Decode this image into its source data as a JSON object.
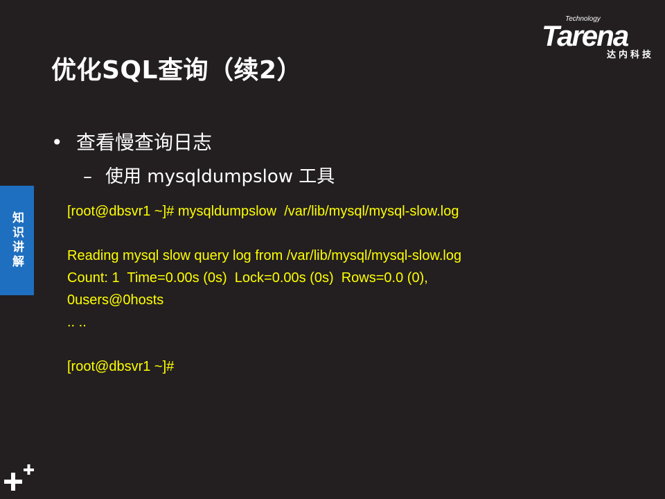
{
  "slide": {
    "title": "优化SQL查询（续2）",
    "bullet": "查看慢查询日志",
    "sub_bullet": "使用 mysqldumpslow 工具",
    "code_lines": [
      "[root@dbsvr1 ~]# mysqldumpslow  /var/lib/mysql/mysql-slow.log",
      "",
      "Reading mysql slow query log from /var/lib/mysql/mysql-slow.log",
      "Count: 1  Time=0.00s (0s)  Lock=0.00s (0s)  Rows=0.0 (0),",
      "0users@0hosts",
      ".. ..",
      "",
      "[root@dbsvr1 ~]#"
    ]
  },
  "side_tab": {
    "label": "知识讲解"
  },
  "logo": {
    "brand": "Tarena",
    "tagline": "Technology",
    "cn": "达内科技"
  },
  "icons": {
    "bullet": "bullet-dot-icon",
    "dash": "dash-icon",
    "corner": "plus-icon"
  },
  "colors": {
    "background": "#231f20",
    "code": "#ffff00",
    "tab": "#1f6fc0",
    "text": "#ffffff"
  }
}
